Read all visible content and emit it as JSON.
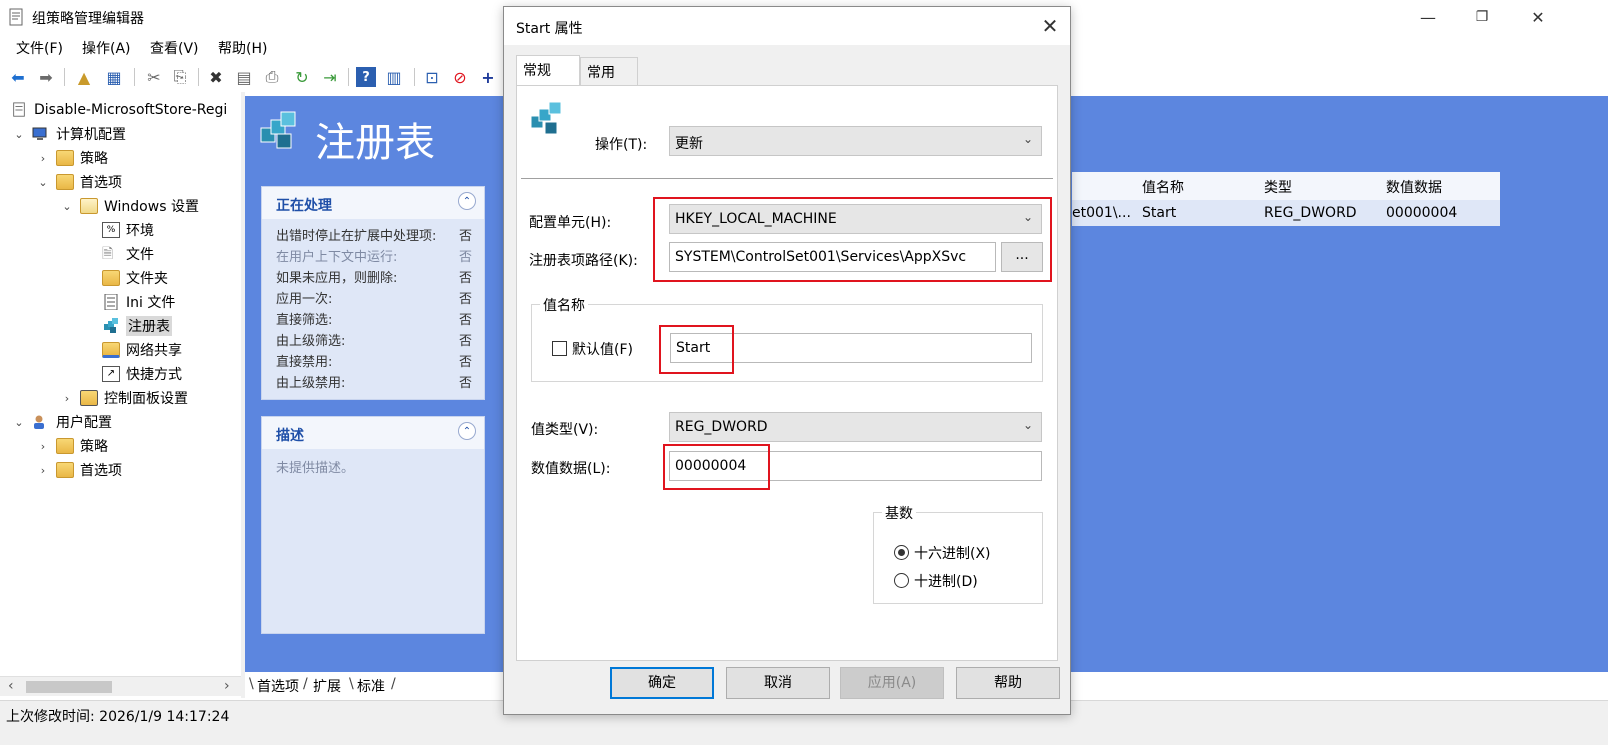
{
  "window": {
    "title": "组策略管理编辑器",
    "minimize": "—",
    "restore": "❐",
    "close": "✕"
  },
  "menu": [
    "文件(F)",
    "操作(A)",
    "查看(V)",
    "帮助(H)"
  ],
  "tree": {
    "root": "Disable-MicrosoftStore-Regi",
    "computer_config": "计算机配置",
    "policies": "策略",
    "preferences": "首选项",
    "windows_settings": "Windows 设置",
    "environment": "环境",
    "files": "文件",
    "folders": "文件夹",
    "ini_files": "Ini 文件",
    "registry": "注册表",
    "network_shares": "网络共享",
    "shortcuts": "快捷方式",
    "control_panel": "控制面板设置",
    "user_config": "用户配置",
    "user_policies": "策略",
    "user_preferences": "首选项"
  },
  "right_panel": {
    "title": "注册表",
    "processing": {
      "header": "正在处理",
      "rows": [
        {
          "k": "出错时停止在扩展中处理项:",
          "v": "否"
        },
        {
          "k": "在用户上下文中运行:",
          "v": "否"
        },
        {
          "k": "如果未应用，则删除:",
          "v": "否"
        },
        {
          "k": "应用一次:",
          "v": "否"
        },
        {
          "k": "直接筛选:",
          "v": "否"
        },
        {
          "k": "由上级筛选:",
          "v": "否"
        },
        {
          "k": "直接禁用:",
          "v": "否"
        },
        {
          "k": "由上级禁用:",
          "v": "否"
        }
      ]
    },
    "description": {
      "header": "描述",
      "text": "未提供描述。"
    },
    "list": {
      "headers": [
        "值名称",
        "类型",
        "数值数据"
      ],
      "row": {
        "path_tail": "et001\\...",
        "name": "Start",
        "type": "REG_DWORD",
        "data": "00000004"
      }
    }
  },
  "bottom_tabs": [
    "首选项",
    "扩展",
    "标准"
  ],
  "status": "上次修改时间: 2026/1/9 14:17:24",
  "dialog": {
    "title": "Start 属性",
    "tabs": [
      "常规",
      "常用"
    ],
    "action_label": "操作(T):",
    "action_value": "更新",
    "hive_label": "配置单元(H):",
    "hive_value": "HKEY_LOCAL_MACHINE",
    "key_path_label": "注册表项路径(K):",
    "key_path_value": "SYSTEM\\ControlSet001\\Services\\AppXSvc",
    "browse_label": "...",
    "value_name_group": "值名称",
    "default_label": "默认值(F)",
    "value_name": "Start",
    "value_type_label": "值类型(V):",
    "value_type": "REG_DWORD",
    "value_data_label": "数值数据(L):",
    "value_data": "00000004",
    "base_group": "基数",
    "hex_label": "十六进制(X)",
    "dec_label": "十进制(D)",
    "buttons": {
      "ok": "确定",
      "cancel": "取消",
      "apply": "应用(A)",
      "help": "帮助"
    }
  },
  "colors": {
    "panel_blue": "#5c86df",
    "highlight_red": "#e0141e"
  }
}
